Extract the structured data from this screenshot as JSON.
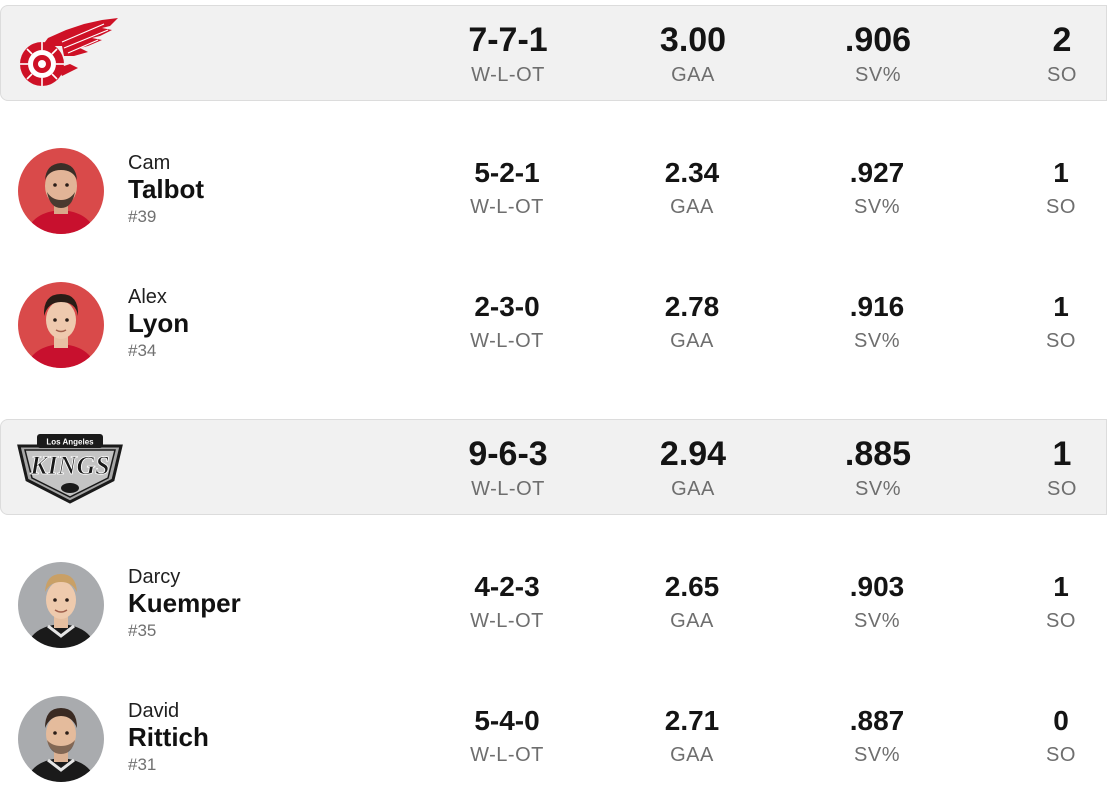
{
  "teams": [
    {
      "logo_icon": "red-wings-logo",
      "color": "#ce1126",
      "stats": {
        "record": "7-7-1",
        "record_label": "W-L-OT",
        "gaa": "3.00",
        "gaa_label": "GAA",
        "sv": ".906",
        "sv_label": "SV%",
        "so": "2",
        "so_label": "SO"
      },
      "goalies": [
        {
          "first": "Cam",
          "last": "Talbot",
          "number": "#39",
          "stats": {
            "record": "5-2-1",
            "record_label": "W-L-OT",
            "gaa": "2.34",
            "gaa_label": "GAA",
            "sv": ".927",
            "sv_label": "SV%",
            "so": "1",
            "so_label": "SO"
          }
        },
        {
          "first": "Alex",
          "last": "Lyon",
          "number": "#34",
          "stats": {
            "record": "2-3-0",
            "record_label": "W-L-OT",
            "gaa": "2.78",
            "gaa_label": "GAA",
            "sv": ".916",
            "sv_label": "SV%",
            "so": "1",
            "so_label": "SO"
          }
        }
      ]
    },
    {
      "logo_icon": "kings-logo",
      "logo_text": "KINGS",
      "logo_subtext": "Los Angeles",
      "color": "#111111",
      "stats": {
        "record": "9-6-3",
        "record_label": "W-L-OT",
        "gaa": "2.94",
        "gaa_label": "GAA",
        "sv": ".885",
        "sv_label": "SV%",
        "so": "1",
        "so_label": "SO"
      },
      "goalies": [
        {
          "first": "Darcy",
          "last": "Kuemper",
          "number": "#35",
          "stats": {
            "record": "4-2-3",
            "record_label": "W-L-OT",
            "gaa": "2.65",
            "gaa_label": "GAA",
            "sv": ".903",
            "sv_label": "SV%",
            "so": "1",
            "so_label": "SO"
          }
        },
        {
          "first": "David",
          "last": "Rittich",
          "number": "#31",
          "stats": {
            "record": "5-4-0",
            "record_label": "W-L-OT",
            "gaa": "2.71",
            "gaa_label": "GAA",
            "sv": ".887",
            "sv_label": "SV%",
            "so": "0",
            "so_label": "SO"
          }
        }
      ]
    }
  ]
}
